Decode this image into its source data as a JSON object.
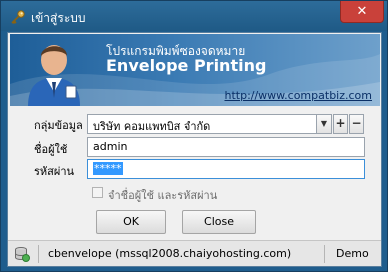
{
  "window": {
    "title": "เข้าสู่ระบบ",
    "close_glyph": "✕"
  },
  "banner": {
    "thai_title": "โปรแกรมพิมพ์ซองจดหมาย",
    "app_name": "Envelope Printing",
    "url": "http://www.compatbiz.com"
  },
  "form": {
    "group_label": "กลุ่มข้อมูล",
    "group_value": "บริษัท คอมแพทบิส จำกัด",
    "group_add": "+",
    "group_remove": "−",
    "user_label": "ชื่อผู้ใช้",
    "user_value": "admin",
    "password_label": "รหัสผ่าน",
    "password_value": "*****",
    "remember_label": "จำชื่อผู้ใช้ และรหัสผ่าน",
    "remember_checked": false
  },
  "buttons": {
    "ok": "OK",
    "close": "Close"
  },
  "status": {
    "connection": "cbenvelope (mssql2008.chaiyohosting.com)",
    "mode": "Demo"
  },
  "icons": {
    "title": "key-icon",
    "banner": "user-avatar-icon",
    "status": "database-icon",
    "combo": "chevron-down-icon"
  }
}
